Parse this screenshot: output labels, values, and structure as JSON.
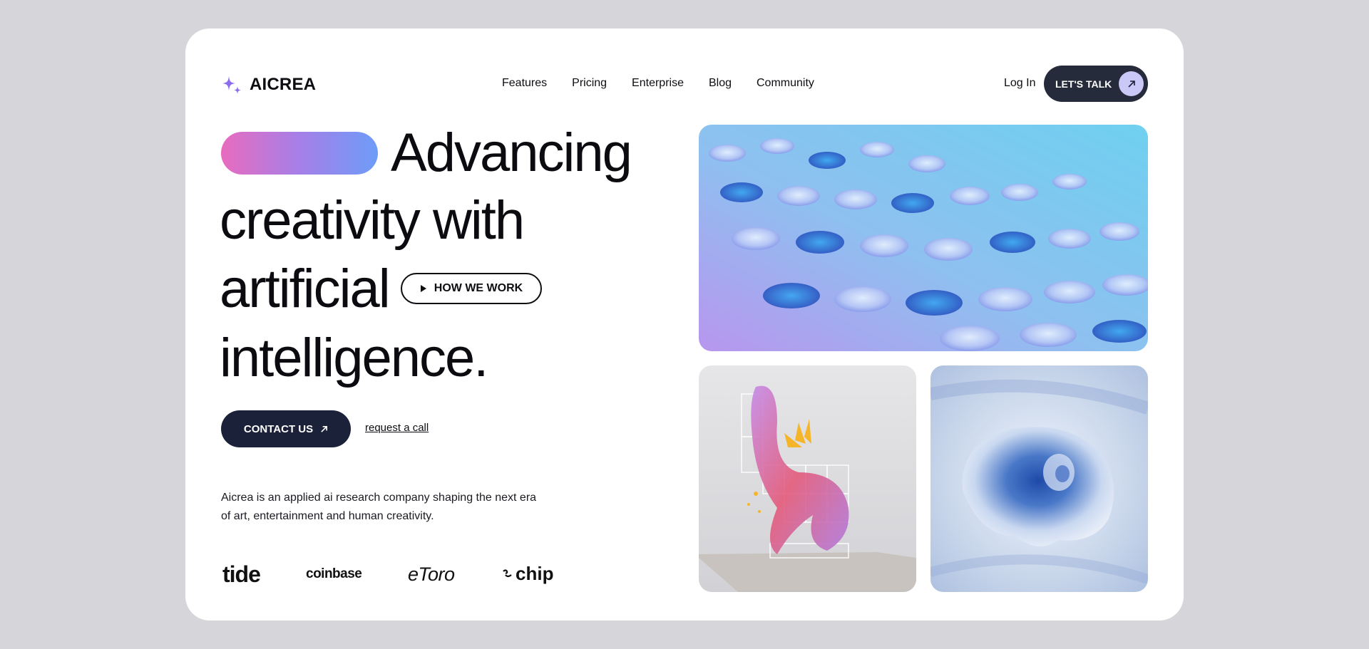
{
  "brand": {
    "name": "AICREA",
    "icon": "sparkle-icon",
    "accent": "#8b6cf0"
  },
  "nav": {
    "items": [
      "Features",
      "Pricing",
      "Enterprise",
      "Blog",
      "Community"
    ]
  },
  "header": {
    "login": "Log In",
    "cta": "LET'S TALK",
    "cta_icon": "arrow-up-right-icon"
  },
  "hero": {
    "line1": "Advancing",
    "line2": "creativity with",
    "line3": "artificial",
    "line4": "intelligence.",
    "how_button": "HOW WE WORK",
    "how_icon": "play-icon",
    "contact_button": "CONTACT US",
    "request_link": "request a call",
    "description": "Aicrea is an applied ai research company shaping the next era of art, entertainment and human creativity."
  },
  "partners": [
    "tide",
    "coinbase",
    "eToro",
    "chip"
  ],
  "colors": {
    "dark_button": "#1b2138",
    "talk_button": "#262b3c",
    "talk_circle": "#c9c8f6",
    "gradient": [
      "#e86cbe",
      "#6e9cf8"
    ]
  }
}
